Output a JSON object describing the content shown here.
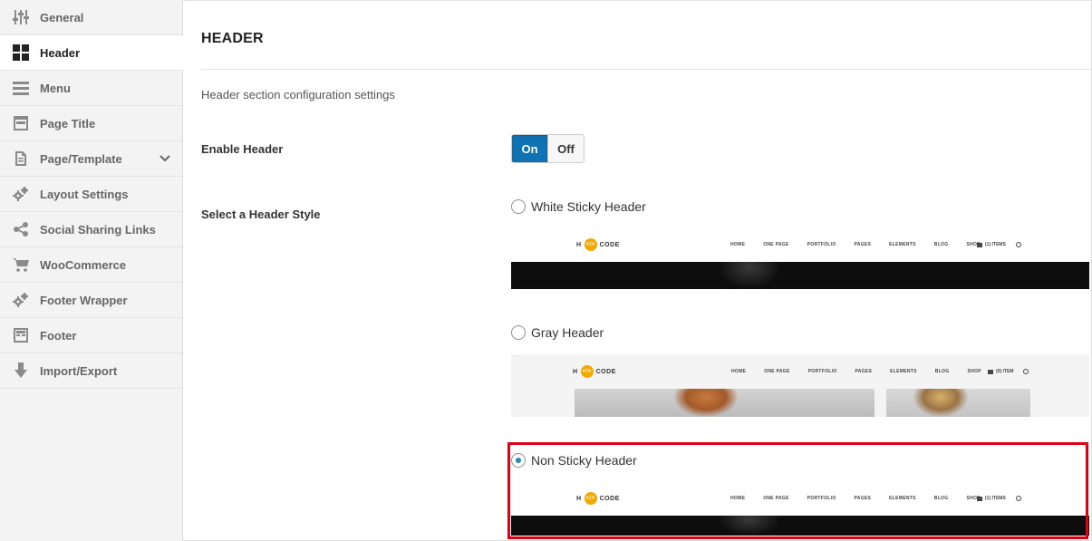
{
  "sidebar": {
    "items": [
      {
        "label": "General",
        "icon": "sliders-icon"
      },
      {
        "label": "Header",
        "icon": "grid-icon",
        "active": true
      },
      {
        "label": "Menu",
        "icon": "menu-icon"
      },
      {
        "label": "Page Title",
        "icon": "window-icon"
      },
      {
        "label": "Page/Template",
        "icon": "document-icon",
        "expandable": true
      },
      {
        "label": "Layout Settings",
        "icon": "cogs-icon"
      },
      {
        "label": "Social Sharing Links",
        "icon": "share-icon"
      },
      {
        "label": "WooCommerce",
        "icon": "cart-icon"
      },
      {
        "label": "Footer Wrapper",
        "icon": "cogs-icon"
      },
      {
        "label": "Footer",
        "icon": "window-icon"
      },
      {
        "label": "Import/Export",
        "icon": "arrow-down-icon"
      }
    ]
  },
  "main": {
    "title": "HEADER",
    "description": "Header section configuration settings",
    "enable_header": {
      "label": "Enable Header",
      "on_label": "On",
      "off_label": "Off",
      "value": "On"
    },
    "header_style": {
      "label": "Select a Header Style",
      "options": [
        {
          "label": "White Sticky Header",
          "selected": false
        },
        {
          "label": "Gray Header",
          "selected": false
        },
        {
          "label": "Non Sticky Header",
          "selected": true
        }
      ]
    },
    "preview": {
      "logo_left": "H",
      "logo_right": "CODE",
      "logo_mark": "</>",
      "nav": [
        "HOME",
        "ONE PAGE",
        "PORTFOLIO",
        "PAGES",
        "ELEMENTS",
        "BLOG",
        "SHOP"
      ],
      "cart_sticky": "(1) ITEMS",
      "cart_gray": "(0) ITEM"
    }
  },
  "colors": {
    "accent": "#0f73b3",
    "highlight": "#e00014",
    "logo": "#f5a800"
  }
}
